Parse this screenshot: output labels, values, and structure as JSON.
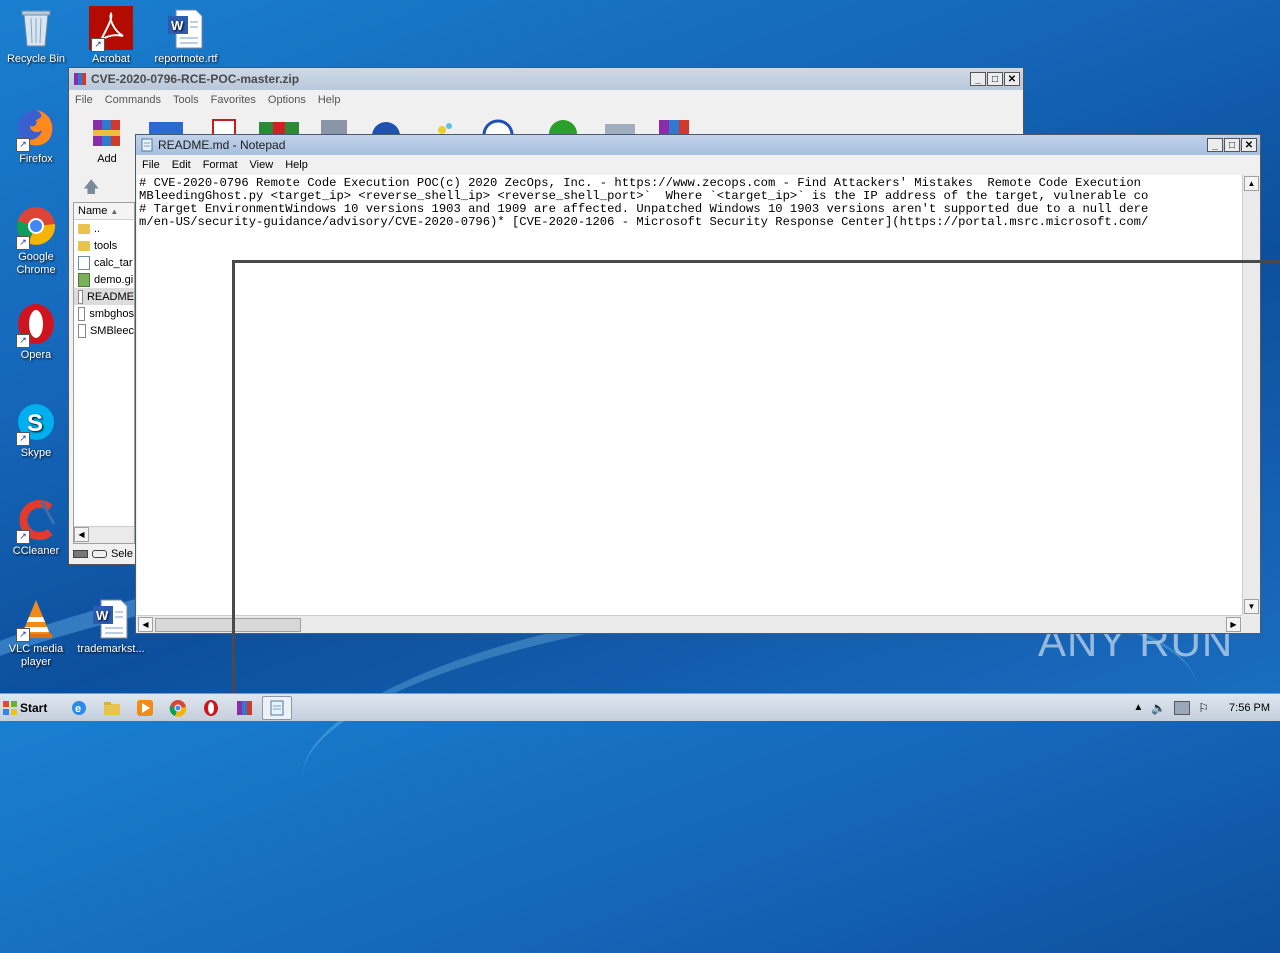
{
  "desktop": {
    "icons": [
      {
        "label": "Recycle Bin",
        "icon": "recycle-bin-icon"
      },
      {
        "label": "Acrobat",
        "icon": "acrobat-icon"
      },
      {
        "label": "reportnote.rtf",
        "icon": "word-document-icon"
      },
      {
        "label": "Firefox",
        "icon": "firefox-icon"
      },
      {
        "label": "Google Chrome",
        "icon": "chrome-icon"
      },
      {
        "label": "Opera",
        "icon": "opera-icon"
      },
      {
        "label": "Skype",
        "icon": "skype-icon"
      },
      {
        "label": "CCleaner",
        "icon": "ccleaner-icon"
      },
      {
        "label": "VLC media player",
        "icon": "vlc-icon"
      },
      {
        "label": "trademarkst...",
        "icon": "word-document-icon"
      }
    ],
    "watermark": "ANY RUN"
  },
  "winrar": {
    "title": "CVE-2020-0796-RCE-POC-master.zip",
    "menu": [
      "File",
      "Commands",
      "Tools",
      "Favorites",
      "Options",
      "Help"
    ],
    "toolbar_add_label": "Add",
    "column_name": "Name",
    "files": [
      "..",
      "tools",
      "calc_tar",
      "demo.gi",
      "README",
      "smbghos",
      "SMBleec"
    ],
    "status_text": "Sele"
  },
  "notepad": {
    "title": "README.md - Notepad",
    "menu": [
      "File",
      "Edit",
      "Format",
      "View",
      "Help"
    ],
    "lines": [
      "# CVE-2020-0796 Remote Code Execution POC(c) 2020 ZecOps, Inc. - https://www.zecops.com - Find Attackers' Mistakes  Remote Code Execution",
      "MBleedingGhost.py <target_ip> <reverse_shell_ip> <reverse_shell_port>`  Where `<target_ip>` is the IP address of the target, vulnerable co",
      "# Target EnvironmentWindows 10 versions 1903 and 1909 are affected. Unpatched Windows 10 1903 versions aren't supported due to a null dere",
      "m/en-US/security-guidance/advisory/CVE-2020-0796)* [CVE-2020-1206 - Microsoft Security Response Center](https://portal.msrc.microsoft.com/"
    ]
  },
  "taskbar": {
    "start_label": "Start",
    "clock": "7:56 PM"
  }
}
